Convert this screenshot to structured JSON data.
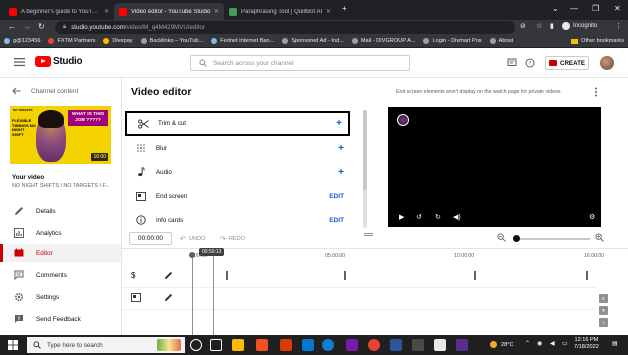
{
  "browser": {
    "tabs": [
      {
        "title": "A beginner's guide to YouTube S",
        "favicon_color": "#ff0000",
        "active": false
      },
      {
        "title": "Video editor - YouTube Studio",
        "favicon_color": "#ff0000",
        "active": true
      },
      {
        "title": "Paraphrasing Tool | QuillBot AI",
        "favicon_color": "#499c55",
        "active": false
      }
    ],
    "new_tab_label": "+",
    "url_host": "studio.youtube.com",
    "url_path": "/video/M_q4M429MVU/editor",
    "incognito_label": "Incognito",
    "bookmarks": [
      {
        "label": "g@123456",
        "color": "#8ab4f8"
      },
      {
        "label": "FXTM Partners",
        "color": "#ea4335"
      },
      {
        "label": "Divepay",
        "color": "#fbbc04"
      },
      {
        "label": "Backlinko – YouTub...",
        "color": "#9aa0a6"
      },
      {
        "label": "Fednet Internet Ban...",
        "color": "#8ab4f8"
      },
      {
        "label": "Sponsored Ad - Ind...",
        "color": "#9aa0a6"
      },
      {
        "label": "Mail - DIVGROUP A...",
        "color": "#9aa0a6"
      },
      {
        "label": "Login - Divmart Pos",
        "color": "#9aa0a6"
      },
      {
        "label": "About",
        "color": "#9aa0a6"
      }
    ],
    "other_bookmarks_label": "Other bookmarks"
  },
  "header": {
    "logo_text": "Studio",
    "search_placeholder": "Search across your channel",
    "create_label": "CREATE"
  },
  "sidebar": {
    "back_label": "Channel content",
    "thumbnail": {
      "badge": "NO TARGETS",
      "side_text": "FLEXIBLE TIMINGS NO NIGHT SHIFT",
      "headline": "WHAT IS THIS JOB ?????",
      "duration": "16:00"
    },
    "your_video_label": "Your video",
    "video_title": "NO NIGHT SHIFTS I NO TARGETS I F...",
    "nav": [
      {
        "label": "Details",
        "icon": "pencil-icon",
        "active": false
      },
      {
        "label": "Analytics",
        "icon": "analytics-icon",
        "active": false
      },
      {
        "label": "Editor",
        "icon": "editor-icon",
        "active": true
      },
      {
        "label": "Comments",
        "icon": "comments-icon",
        "active": false
      },
      {
        "label": "Settings",
        "icon": "gear-icon",
        "active": false
      },
      {
        "label": "Send Feedback",
        "icon": "feedback-icon",
        "active": false
      }
    ]
  },
  "editor": {
    "title": "Video editor",
    "end_screen_note": "End screen elements won't display on the watch page for private videos.",
    "tools": [
      {
        "label": "Trim & cut",
        "action": "+",
        "icon": "scissors-icon"
      },
      {
        "label": "Blur",
        "action": "+",
        "icon": "blur-icon"
      },
      {
        "label": "Audio",
        "action": "+",
        "icon": "music-note-icon"
      },
      {
        "label": "End screen",
        "action": "EDIT",
        "icon": "end-screen-icon"
      },
      {
        "label": "Info cards",
        "action": "EDIT",
        "icon": "info-icon"
      }
    ]
  },
  "timeline": {
    "timecode": "00:00:00",
    "undo_label": "UNDO",
    "redo_label": "REDO",
    "hover_time": "00:50:13",
    "tick_labels": [
      "00:00",
      "05:00:00",
      "10:00:00",
      "16:00:00"
    ]
  },
  "taskbar": {
    "search_placeholder": "Type here to search",
    "weather": "28°C",
    "time": "12:16 PM",
    "date": "7/18/2022"
  }
}
